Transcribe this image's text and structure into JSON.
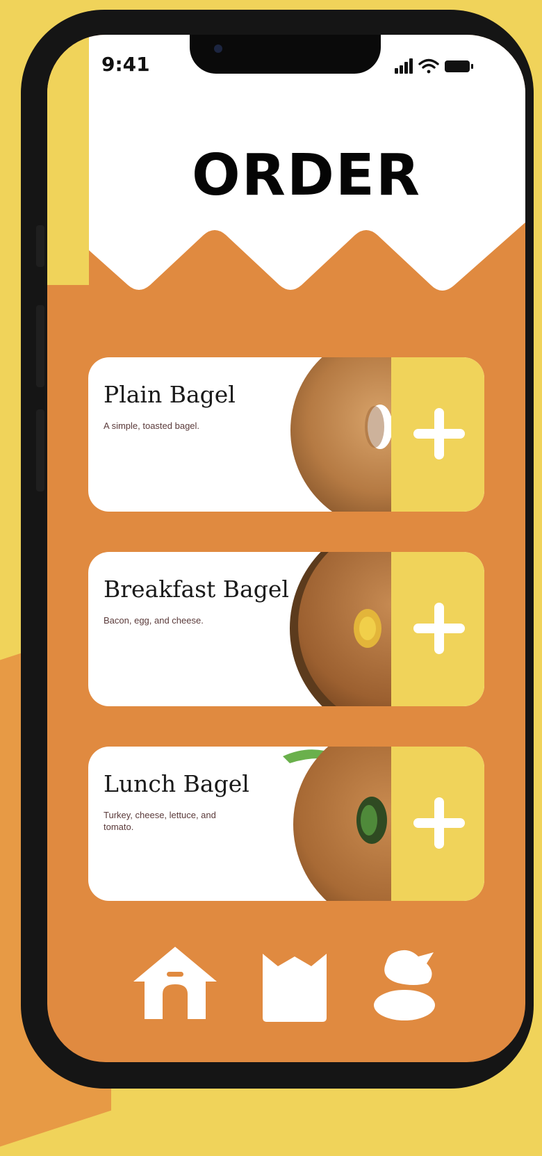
{
  "status_bar": {
    "time": "9:41",
    "signal_icon": "signal-icon",
    "wifi_icon": "wifi-icon",
    "battery_icon": "battery-icon"
  },
  "header": {
    "title": "ORDER"
  },
  "menu": {
    "items": [
      {
        "name": "Plain Bagel",
        "description": "A simple, toasted bagel.",
        "image": "plain-bagel-photo",
        "add_icon": "plus-icon"
      },
      {
        "name": "Breakfast Bagel",
        "description": "Bacon, egg, and cheese.",
        "image": "breakfast-bagel-photo",
        "add_icon": "plus-icon"
      },
      {
        "name": "Lunch Bagel",
        "description": "Turkey, cheese, lettuce, and tomato.",
        "image": "lunch-bagel-photo",
        "add_icon": "plus-icon"
      }
    ]
  },
  "tab_bar": {
    "tabs": [
      {
        "icon": "home-icon"
      },
      {
        "icon": "bag-icon"
      },
      {
        "icon": "profile-icon"
      }
    ]
  },
  "colors": {
    "background": "#F0D35A",
    "screen": "#E08A40",
    "accent": "#F0D35A",
    "card": "#FFFFFF",
    "title": "#050505"
  }
}
